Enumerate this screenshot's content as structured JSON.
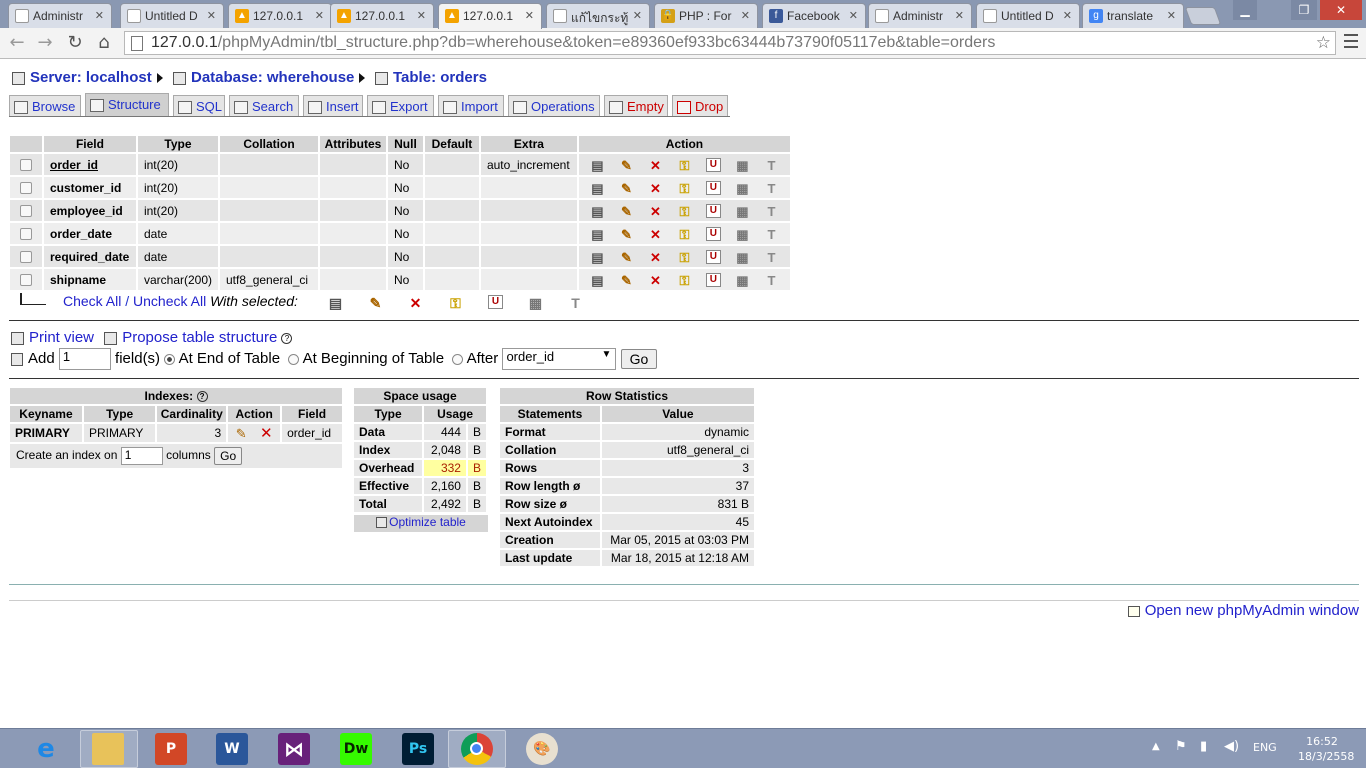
{
  "browser": {
    "tabs": [
      {
        "title": "Administr",
        "fav": "doc-icon",
        "active": false
      },
      {
        "title": "Untitled D",
        "fav": "doc-icon",
        "active": false
      },
      {
        "title": "127.0.0.1",
        "fav": "pma-icon",
        "active": false
      },
      {
        "title": "127.0.0.1",
        "fav": "pma-icon",
        "active": false
      },
      {
        "title": "127.0.0.1",
        "fav": "pma-icon",
        "active": true
      },
      {
        "title": "แก้ไขกระทู้",
        "fav": "doc-icon",
        "active": false
      },
      {
        "title": "PHP : For",
        "fav": "lock-icon",
        "active": false
      },
      {
        "title": "Facebook",
        "fav": "facebook-icon",
        "active": false
      },
      {
        "title": "Administr",
        "fav": "doc-icon",
        "active": false
      },
      {
        "title": "Untitled D",
        "fav": "doc-icon",
        "active": false
      },
      {
        "title": "translate",
        "fav": "google-icon",
        "active": false
      }
    ],
    "url_host": "127.0.0.1",
    "url_rest": "/phpMyAdmin/tbl_structure.php?db=wherehouse&token=e89360ef933bc63444b73790f05117eb&table=orders"
  },
  "breadcrumb": {
    "server": "Server: localhost",
    "database": "Database: wherehouse",
    "table": "Table: orders"
  },
  "pma_tabs": [
    "Browse",
    "Structure",
    "SQL",
    "Search",
    "Insert",
    "Export",
    "Import",
    "Operations",
    "Empty",
    "Drop"
  ],
  "structure": {
    "headers": [
      "Field",
      "Type",
      "Collation",
      "Attributes",
      "Null",
      "Default",
      "Extra",
      "Action"
    ],
    "rows": [
      {
        "field": "order_id",
        "type": "int(20)",
        "collation": "",
        "attributes": "",
        "null": "No",
        "default": "",
        "extra": "auto_increment"
      },
      {
        "field": "customer_id",
        "type": "int(20)",
        "collation": "",
        "attributes": "",
        "null": "No",
        "default": "",
        "extra": ""
      },
      {
        "field": "employee_id",
        "type": "int(20)",
        "collation": "",
        "attributes": "",
        "null": "No",
        "default": "",
        "extra": ""
      },
      {
        "field": "order_date",
        "type": "date",
        "collation": "",
        "attributes": "",
        "null": "No",
        "default": "",
        "extra": ""
      },
      {
        "field": "required_date",
        "type": "date",
        "collation": "",
        "attributes": "",
        "null": "No",
        "default": "",
        "extra": ""
      },
      {
        "field": "shipname",
        "type": "varchar(200)",
        "collation": "utf8_general_ci",
        "attributes": "",
        "null": "No",
        "default": "",
        "extra": ""
      }
    ],
    "check_all": "Check All",
    "separator": "/",
    "uncheck_all": "Uncheck All",
    "with_selected": "With selected:"
  },
  "options": {
    "print_view": "Print view",
    "propose": "Propose table structure",
    "add_label": "Add",
    "add_value": "1",
    "fields_label": "field(s)",
    "at_end": "At End of Table",
    "at_beginning": "At Beginning of Table",
    "after": "After",
    "after_select": "order_id",
    "go": "Go"
  },
  "indexes": {
    "title": "Indexes:",
    "headers": [
      "Keyname",
      "Type",
      "Cardinality",
      "Action",
      "Field"
    ],
    "row": {
      "keyname": "PRIMARY",
      "type": "PRIMARY",
      "cardinality": "3",
      "field": "order_id"
    },
    "create_label": "Create an index on",
    "create_value": "1",
    "columns_label": "columns",
    "go": "Go"
  },
  "space_usage": {
    "title": "Space usage",
    "headers": [
      "Type",
      "Usage"
    ],
    "rows": [
      {
        "type": "Data",
        "value": "444",
        "unit": "B"
      },
      {
        "type": "Index",
        "value": "2,048",
        "unit": "B"
      },
      {
        "type": "Overhead",
        "value": "332",
        "unit": "B"
      },
      {
        "type": "Effective",
        "value": "2,160",
        "unit": "B"
      },
      {
        "type": "Total",
        "value": "2,492",
        "unit": "B"
      }
    ],
    "optimize": "Optimize table",
    "highlight_color": "#ffffa0"
  },
  "row_stats": {
    "title": "Row Statistics",
    "headers": [
      "Statements",
      "Value"
    ],
    "rows": [
      {
        "k": "Format",
        "v": "dynamic"
      },
      {
        "k": "Collation",
        "v": "utf8_general_ci"
      },
      {
        "k": "Rows",
        "v": "3"
      },
      {
        "k": "Row length ø",
        "v": "37"
      },
      {
        "k": "Row size ø",
        "v": "831 B"
      },
      {
        "k": "Next Autoindex",
        "v": "45"
      },
      {
        "k": "Creation",
        "v": "Mar 05, 2015 at 03:03 PM"
      },
      {
        "k": "Last update",
        "v": "Mar 18, 2015 at 12:18 AM"
      }
    ]
  },
  "footer": {
    "new_window": "Open new phpMyAdmin window"
  },
  "taskbar": {
    "apps": [
      "ie-icon",
      "explorer-icon",
      "powerpoint-icon",
      "word-icon",
      "visual-studio-icon",
      "dreamweaver-icon",
      "photoshop-icon",
      "chrome-icon",
      "paint-icon"
    ],
    "dw_label": "Dw",
    "ps_label": "Ps",
    "w_label": "W",
    "p_label": "P",
    "lang": "ENG",
    "time": "16:52",
    "date": "18/3/2558"
  },
  "colors": {
    "link": "#2233cc",
    "drop_red": "#cc0000",
    "chrome_frame": "#8a98b2"
  }
}
